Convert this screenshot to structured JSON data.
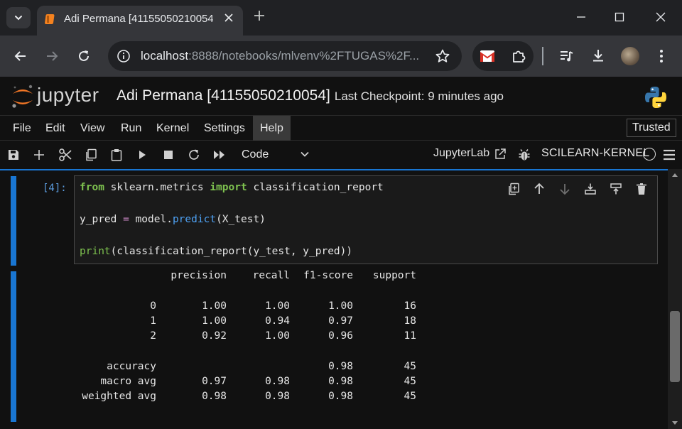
{
  "browser": {
    "tab_title": "Adi Permana [41155050210054]",
    "url_host": "localhost",
    "url_rest": ":8888/notebooks/mlvenv%2FTUGAS%2F..."
  },
  "header": {
    "logo_text": "jupyter",
    "notebook_title": "Adi Permana [41155050210054]",
    "checkpoint": "Last Checkpoint: 9 minutes ago"
  },
  "menu": {
    "items": [
      "File",
      "Edit",
      "View",
      "Run",
      "Kernel",
      "Settings",
      "Help"
    ],
    "trusted": "Trusted"
  },
  "toolbar": {
    "cell_type": "Code",
    "jupyterlab_link": "JupyterLab",
    "kernel_name": "SCILEARN-KERNEL"
  },
  "cell": {
    "prompt": "[4]:",
    "code": {
      "l1": {
        "kw_from": "from",
        "module": " sklearn.metrics ",
        "kw_import": "import",
        "name": " classification_report"
      },
      "l2": {
        "lhs": "y_pred ",
        "op": "=",
        "obj": " model.",
        "fn": "predict",
        "args": "(X_test)"
      },
      "l3": {
        "fn": "print",
        "args": "(classification_report(y_test, y_pred))"
      }
    }
  },
  "output": {
    "headers": [
      "precision",
      "recall",
      "f1-score",
      "support"
    ],
    "rows": [
      {
        "label": "0",
        "precision": "1.00",
        "recall": "1.00",
        "f1": "1.00",
        "support": "16"
      },
      {
        "label": "1",
        "precision": "1.00",
        "recall": "0.94",
        "f1": "0.97",
        "support": "18"
      },
      {
        "label": "2",
        "precision": "0.92",
        "recall": "1.00",
        "f1": "0.96",
        "support": "11"
      },
      {
        "label": "accuracy",
        "precision": "",
        "recall": "",
        "f1": "0.98",
        "support": "45"
      },
      {
        "label": "macro avg",
        "precision": "0.97",
        "recall": "0.98",
        "f1": "0.98",
        "support": "45"
      },
      {
        "label": "weighted avg",
        "precision": "0.98",
        "recall": "0.98",
        "f1": "0.98",
        "support": "45"
      }
    ]
  },
  "colors": {
    "accent": "#1976d2",
    "keyword": "#7ec24f",
    "function": "#4ea1f3",
    "operator": "#c586c0",
    "prompt": "#5c9de0",
    "tab_favicon": "#f5821f",
    "gmail": "#d93025"
  },
  "icons": {
    "tab_strip": [
      "chevron-down-icon",
      "notebook-favicon-icon",
      "close-icon",
      "plus-icon",
      "minimize-icon",
      "maximize-icon",
      "close-window-icon"
    ],
    "nav": [
      "back-icon",
      "forward-icon",
      "reload-icon",
      "site-info-icon",
      "star-icon",
      "gmail-icon",
      "extensions-icon",
      "media-icon",
      "download-icon",
      "avatar",
      "kebab-menu-icon"
    ],
    "notebook_toolbar": [
      "save-icon",
      "add-cell-icon",
      "cut-icon",
      "copy-icon",
      "paste-icon",
      "run-icon",
      "stop-icon",
      "restart-icon",
      "fast-forward-icon",
      "external-link-icon",
      "bug-icon",
      "kernel-status-icon",
      "list-icon"
    ],
    "cell_toolbar": [
      "duplicate-icon",
      "move-up-icon",
      "move-down-icon",
      "insert-above-icon",
      "insert-below-icon",
      "delete-icon"
    ]
  }
}
